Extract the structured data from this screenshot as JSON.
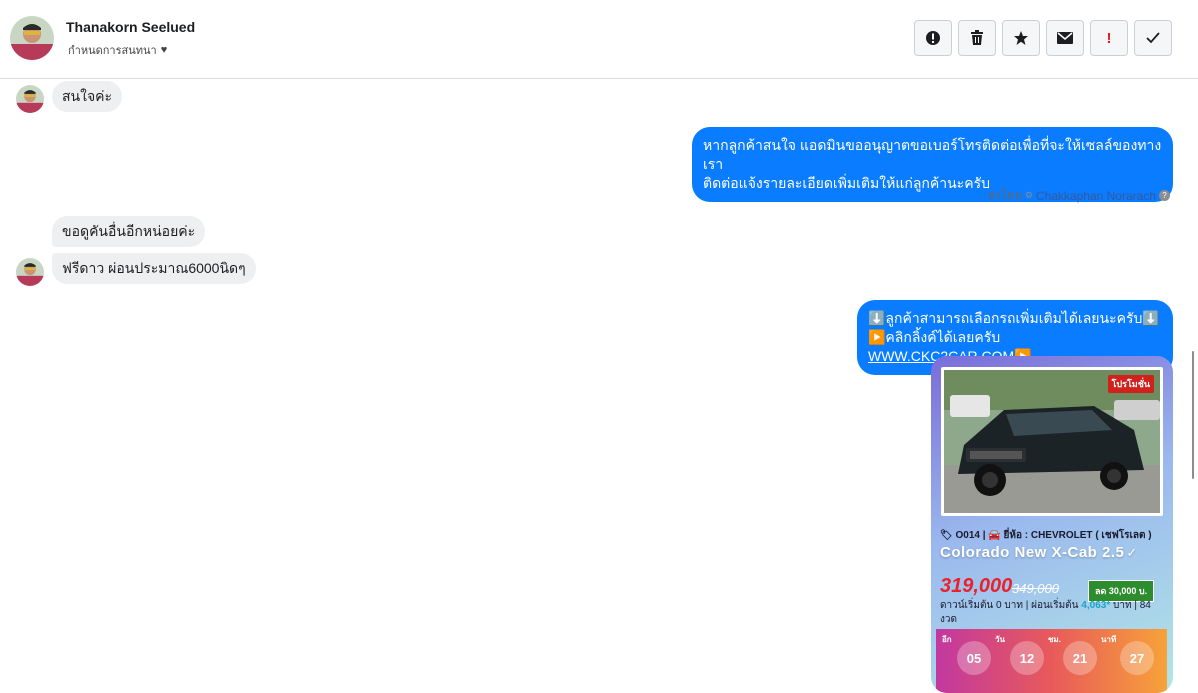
{
  "header": {
    "name": "Thanakorn Seelued",
    "subtitle": "กำหนดการสนทนา",
    "toolbar": [
      {
        "icon": "exclamation-circle-icon",
        "glyph": "!"
      },
      {
        "icon": "trash-icon",
        "glyph": "🗑"
      },
      {
        "icon": "star-icon",
        "glyph": "★"
      },
      {
        "icon": "envelope-icon",
        "glyph": "✉"
      },
      {
        "icon": "important-icon",
        "glyph": "!"
      },
      {
        "icon": "checkmark-icon",
        "glyph": "✓"
      }
    ]
  },
  "messages": {
    "m1": "สนใจค่ะ",
    "m2": "หากลูกค้าสนใจ แอดมินขออนุญาตขอเบอร์โทรติดต่อเพื่อที่จะให้เซลล์ของทางเราติดต่อแจ้งรายละเอียดเพิ่มเติมให้แก่ลูกค้านะครับ",
    "m2_line1": "หากลูกค้าสนใจ แอดมินขออนุญาตขอเบอร์โทรติดต่อเพื่อที่จะให้เซลล์ของทางเรา",
    "m2_line2": "ติดต่อแจ้งรายละเอียดเพิ่มเติมให้แก่ลูกค้านะครับ",
    "sent_by_label": "ส่งโดย",
    "sent_by_name": "Chakkaphan Norarach",
    "m3": "ขอดูคันอื่นอีกหน่อยค่ะ",
    "m4": "ฟรีดาว ผ่อนประมาณ6000นิดๆ",
    "m5_line1": "⬇️ลูกค้าสามารถเลือกรถเพิ่มเติมได้เลยนะครับ⬇️",
    "m5_line2_prefix": "▶️คลิกลิ้งค์ได้เลยครับ ",
    "m5_link": "WWW.CKC2CAR.COM",
    "m5_line2_suffix": "▶️"
  },
  "card": {
    "promo": "โปรโมชั่น",
    "meta": "🏷 O014 | 🚘 ยี่ห้อ : CHEVROLET ( เชฟโรเลต )",
    "title": "Colorado New X-Cab 2.5",
    "price": "319,000",
    "old_price": "349,000",
    "discount": "ลด 30,000 บ.",
    "terms_prefix": "ดาวน์เริ่มต้น 0 บาท | ผ่อนเริ่มต้น ",
    "terms_amount": "4,063*",
    "terms_suffix": " บาท | 84 งวด",
    "countdown": [
      {
        "label": "อีก",
        "value": "05"
      },
      {
        "label": "วัน",
        "value": "12"
      },
      {
        "label": "ชม.",
        "value": "21"
      },
      {
        "label": "นาที",
        "value": "27"
      }
    ]
  }
}
